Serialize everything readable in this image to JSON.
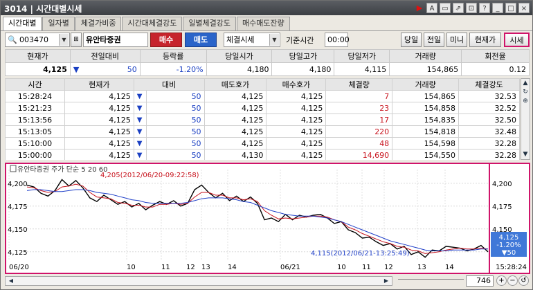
{
  "window": {
    "code": "3014",
    "title": "시간대별시세"
  },
  "title_icons": [
    "play-icon",
    "font-icon",
    "window-icon",
    "popout-icon",
    "settings-icon",
    "help-icon",
    "minimize-icon",
    "maximize-icon",
    "close-icon"
  ],
  "title_glyphs": {
    "font": "A",
    "help": "?",
    "minimize": "_",
    "maximize": "□",
    "close": "×"
  },
  "tabs": [
    {
      "label": "시간대별",
      "active": true
    },
    {
      "label": "일자별"
    },
    {
      "label": "체결가비중"
    },
    {
      "label": "시간대체결강도"
    },
    {
      "label": "일별체결강도"
    },
    {
      "label": "매수매도잔량"
    }
  ],
  "toolbar": {
    "code": "003470",
    "name": "유안타증권",
    "buy_label": "매수",
    "sell_label": "매도",
    "mode": "체결시세",
    "base_time_label": "기준시간",
    "base_time": "00:00",
    "btn_today": "당일",
    "btn_prev": "전일",
    "btn_mini": "미니",
    "btn_price": "현재가",
    "btn_quote": "시세"
  },
  "summary": {
    "headers": [
      "현재가",
      "전일대비",
      "등락률",
      "당일시가",
      "당일고가",
      "당일저가",
      "거래량",
      "회전율"
    ],
    "price": "4,125",
    "change": "50",
    "rate": "-1.20%",
    "open": "4,180",
    "high": "4,180",
    "low": "4,115",
    "volume": "154,865",
    "turnover": "0.12"
  },
  "trades": {
    "headers": [
      "시간",
      "현재가",
      "대비",
      "매도호가",
      "매수호가",
      "체결량",
      "거래량",
      "체결강도"
    ],
    "rows": [
      {
        "time": "15:28:24",
        "price": "4,125",
        "diff": "50",
        "ask": "4,125",
        "bid": "4,125",
        "qty": "7",
        "vol": "154,865",
        "str": "32.53"
      },
      {
        "time": "15:21:23",
        "price": "4,125",
        "diff": "50",
        "ask": "4,125",
        "bid": "4,125",
        "qty": "23",
        "vol": "154,858",
        "str": "32.52"
      },
      {
        "time": "15:13:56",
        "price": "4,125",
        "diff": "50",
        "ask": "4,125",
        "bid": "4,125",
        "qty": "17",
        "vol": "154,835",
        "str": "32.50"
      },
      {
        "time": "15:13:05",
        "price": "4,125",
        "diff": "50",
        "ask": "4,125",
        "bid": "4,125",
        "qty": "220",
        "vol": "154,818",
        "str": "32.48"
      },
      {
        "time": "15:10:00",
        "price": "4,125",
        "diff": "50",
        "ask": "4,125",
        "bid": "4,125",
        "qty": "48",
        "vol": "154,598",
        "str": "32.28"
      },
      {
        "time": "15:00:00",
        "price": "4,125",
        "diff": "50",
        "ask": "4,130",
        "bid": "4,125",
        "qty": "14,690",
        "vol": "154,550",
        "str": "32.28"
      }
    ]
  },
  "chart": {
    "legend": "유안타증권 주가 단순 5 20 60",
    "high_note": "4,205(2012/06/20-09:22:58)",
    "low_note": "4,115(2012/06/21-13:25:49)",
    "y_ticks": [
      "4,200",
      "4,175",
      "4,150",
      "4,125"
    ],
    "x_ticks": [
      "06/20",
      "10",
      "11",
      "12",
      "13",
      "14",
      "06/21",
      "10",
      "11",
      "12",
      "13",
      "14"
    ],
    "last_time": "15:28:24",
    "box_price": "4,125",
    "box_rate": "-1.20%",
    "box_change": "▼50",
    "colors": {
      "price": "#000000",
      "ma5": "#c8141e",
      "ma20": "#1f3fc8",
      "up": "#d0146a"
    }
  },
  "chart_data": {
    "type": "line",
    "y_axis": [
      "4,125",
      "4,150",
      "4,175",
      "4,200"
    ],
    "ylim": [
      4115,
      4215
    ],
    "x_ticks": [
      "06/20",
      "10",
      "11",
      "12",
      "13",
      "14",
      "06/21",
      "10",
      "11",
      "12",
      "13",
      "14"
    ],
    "series": [
      {
        "name": "주가",
        "values": [
          4198,
          4196,
          4189,
          4186,
          4192,
          4204,
          4197,
          4203,
          4195,
          4184,
          4180,
          4187,
          4182,
          4177,
          4180,
          4174,
          4178,
          4171,
          4176,
          4180,
          4177,
          4181,
          4175,
          4178,
          4193,
          4198,
          4190,
          4184,
          4189,
          4181,
          4186,
          4180,
          4185,
          4178,
          4160,
          4162,
          4158,
          4166,
          4160,
          4165,
          4163,
          4165,
          4166,
          4162,
          4156,
          4158,
          4149,
          4146,
          4140,
          4141,
          4136,
          4132,
          4134,
          4128,
          4131,
          4122,
          4125,
          4119,
          4127,
          4126,
          4131,
          4130,
          4129,
          4126,
          4128,
          4132,
          4125
        ]
      },
      {
        "name": "5",
        "values": [
          4196,
          4195,
          4192,
          4190,
          4191,
          4196,
          4197,
          4199,
          4197,
          4190,
          4185,
          4184,
          4183,
          4179,
          4178,
          4176,
          4176,
          4174,
          4174,
          4177,
          4177,
          4178,
          4177,
          4178,
          4185,
          4190,
          4190,
          4187,
          4187,
          4184,
          4184,
          4182,
          4183,
          4180,
          4170,
          4165,
          4161,
          4162,
          4161,
          4162,
          4163,
          4164,
          4164,
          4163,
          4160,
          4158,
          4152,
          4149,
          4145,
          4142,
          4139,
          4136,
          4134,
          4131,
          4130,
          4127,
          4126,
          4123,
          4124,
          4125,
          4127,
          4128,
          4129,
          4128,
          4128,
          4129,
          4128
        ]
      },
      {
        "name": "20",
        "values": [
          4192,
          4193,
          4193,
          4192,
          4191,
          4191,
          4192,
          4193,
          4193,
          4192,
          4190,
          4189,
          4188,
          4186,
          4184,
          4182,
          4181,
          4179,
          4178,
          4178,
          4178,
          4178,
          4178,
          4179,
          4181,
          4183,
          4184,
          4184,
          4184,
          4183,
          4182,
          4180,
          4179,
          4176,
          4173,
          4170,
          4168,
          4166,
          4165,
          4164,
          4164,
          4164,
          4163,
          4162,
          4160,
          4158,
          4155,
          4152,
          4149,
          4146,
          4143,
          4140,
          4137,
          4135,
          4133,
          4131,
          4129,
          4127,
          4126,
          4126,
          4126,
          4127,
          4127,
          4127,
          4127,
          4128,
          4128
        ]
      }
    ],
    "annotations": [
      "4,205(2012/06/20-09:22:58)",
      "4,115(2012/06/21-13:25:49)"
    ]
  },
  "footer": {
    "zoom": "746"
  }
}
